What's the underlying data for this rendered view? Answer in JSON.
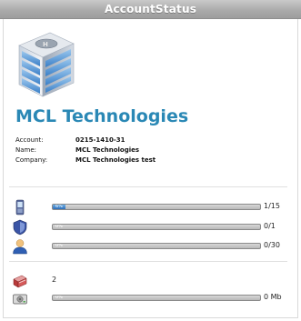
{
  "window": {
    "title": "AccountStatus"
  },
  "company": {
    "name": "MCL Technologies",
    "fields": [
      {
        "label": "Account:",
        "value": "0215-1410-31"
      },
      {
        "label": "Name:",
        "value": "MCL Technologies"
      },
      {
        "label": "Company:",
        "value": "MCL Technologies test"
      }
    ]
  },
  "meters": [
    {
      "icon": "phone-icon",
      "percent_label": "6%",
      "fraction": 0.06,
      "value": "1/15"
    },
    {
      "icon": "shield-icon",
      "percent_label": "0%",
      "fraction": 0,
      "value": "0/1"
    },
    {
      "icon": "user-icon",
      "percent_label": "0%",
      "fraction": 0,
      "value": "0/30"
    }
  ],
  "count": {
    "icon": "book-icon",
    "value": "2"
  },
  "storage": {
    "icon": "hard-drive-icon",
    "percent_label": "0%",
    "fraction": 0,
    "value": "0 Mb"
  },
  "colors": {
    "accent": "#2a88b5",
    "bar_fill": "#2d6db8",
    "titlebar": "#a9a9a9"
  }
}
